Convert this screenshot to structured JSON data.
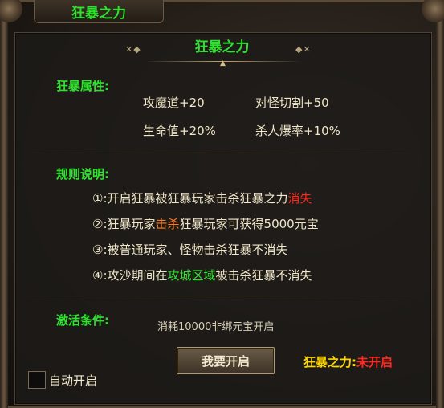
{
  "window": {
    "tab_title": "狂暴之力"
  },
  "panel": {
    "title": "狂暴之力"
  },
  "attributes": {
    "label": "狂暴属性:",
    "items": [
      "攻魔道+20",
      "对怪切割+50",
      "生命值+20%",
      "杀人爆率+10%"
    ]
  },
  "rules": {
    "label": "规则说明:",
    "r1": {
      "num": "①:",
      "pre": "开启狂暴被狂暴玩家击杀狂暴之力",
      "hl": "消失"
    },
    "r2": {
      "num": "②:",
      "pre": "狂暴玩家",
      "hl": "击杀",
      "post": "狂暴玩家可获得5000元宝"
    },
    "r3": {
      "num": "③:",
      "text": "被普通玩家、怪物击杀狂暴不消失"
    },
    "r4": {
      "num": "④:",
      "pre": "攻沙期间在",
      "hl": "攻城区域",
      "post": "被击杀狂暴不消失"
    }
  },
  "activation": {
    "label": "激活条件:",
    "cost": "消耗10000非绑元宝开启"
  },
  "button": {
    "open_label": "我要开启"
  },
  "status": {
    "key": "狂暴之力:",
    "value": "未开启"
  },
  "auto_open": {
    "label": "自动开启",
    "checked": false
  },
  "colors": {
    "accent_green": "#2fe22f",
    "highlight_red": "#ff2a1f",
    "highlight_orange": "#ff7a1f",
    "status_key_yellow": "#ffd700"
  }
}
